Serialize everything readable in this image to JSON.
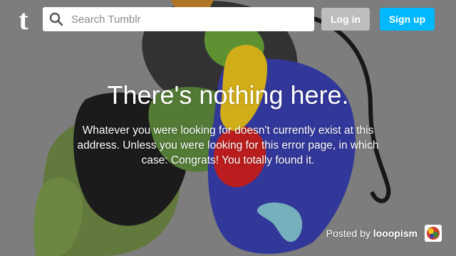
{
  "header": {
    "logo_letter": "t",
    "search": {
      "placeholder": "Search Tumblr",
      "value": ""
    },
    "login_label": "Log in",
    "signup_label": "Sign up"
  },
  "error": {
    "title": "There's nothing here.",
    "message": "Whatever you were looking for doesn't currently exist at this address. Unless you were looking for this error page, in which case: Congrats! You totally found it."
  },
  "credit": {
    "prefix": "Posted by",
    "author": "looopism"
  },
  "colors": {
    "signup_button": "#00b8ff",
    "login_button": "#bdbdbd",
    "background": "#8e8e8e"
  },
  "icons": {
    "logo": "tumblr-logo-icon",
    "search": "search-icon",
    "avatar": "author-avatar"
  }
}
